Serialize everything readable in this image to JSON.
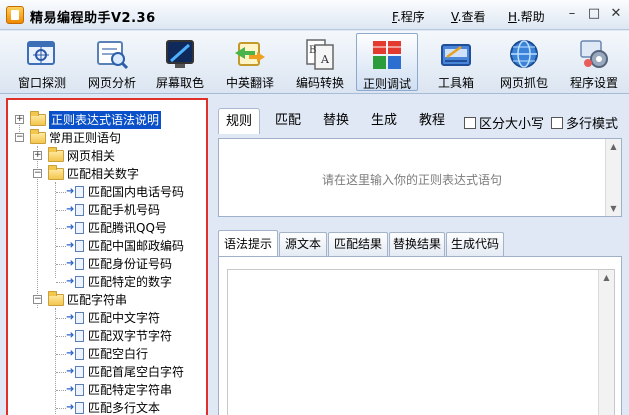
{
  "window": {
    "title": "精易编程助手V2.36",
    "menus": [
      {
        "accel": "F",
        "label": ".程序"
      },
      {
        "accel": "V",
        "label": ".查看"
      },
      {
        "accel": "H",
        "label": ".帮助"
      }
    ],
    "controls": {
      "minimize": "–",
      "maximize": "□",
      "close": "✕"
    }
  },
  "toolbar": {
    "items": [
      {
        "label": "窗口探测",
        "icon": "window-probe-icon"
      },
      {
        "label": "网页分析",
        "icon": "web-analysis-icon"
      },
      {
        "label": "屏幕取色",
        "icon": "color-picker-icon"
      },
      {
        "label": "中英翻译",
        "icon": "translate-icon"
      },
      {
        "label": "编码转换",
        "icon": "encoding-icon"
      },
      {
        "label": "正则调试",
        "icon": "regex-icon",
        "active": true
      },
      {
        "label": "工具箱",
        "icon": "toolbox-icon"
      },
      {
        "label": "网页抓包",
        "icon": "globe-icon"
      },
      {
        "label": "程序设置",
        "icon": "settings-icon"
      }
    ]
  },
  "tree": {
    "items": [
      {
        "label": "正则表达式语法说明",
        "level": 0,
        "type": "folder",
        "expander": "+",
        "selected": true
      },
      {
        "label": "常用正则语句",
        "level": 0,
        "type": "folder",
        "expander": "−"
      },
      {
        "label": "网页相关",
        "level": 1,
        "type": "folder",
        "expander": "+"
      },
      {
        "label": "匹配相关数字",
        "level": 1,
        "type": "folder",
        "expander": "−"
      },
      {
        "label": "匹配国内电话号码",
        "level": 2,
        "type": "doc"
      },
      {
        "label": "匹配手机号码",
        "level": 2,
        "type": "doc"
      },
      {
        "label": "匹配腾讯QQ号",
        "level": 2,
        "type": "doc"
      },
      {
        "label": "匹配中国邮政编码",
        "level": 2,
        "type": "doc"
      },
      {
        "label": "匹配身份证号码",
        "level": 2,
        "type": "doc"
      },
      {
        "label": "匹配特定的数字",
        "level": 2,
        "type": "doc"
      },
      {
        "label": "匹配字符串",
        "level": 1,
        "type": "folder",
        "expander": "−"
      },
      {
        "label": "匹配中文字符",
        "level": 2,
        "type": "doc"
      },
      {
        "label": "匹配双字节字符",
        "level": 2,
        "type": "doc"
      },
      {
        "label": "匹配空白行",
        "level": 2,
        "type": "doc"
      },
      {
        "label": "匹配首尾空白字符",
        "level": 2,
        "type": "doc"
      },
      {
        "label": "匹配特定字符串",
        "level": 2,
        "type": "doc"
      },
      {
        "label": "匹配多行文本",
        "level": 2,
        "type": "doc"
      }
    ]
  },
  "regex": {
    "tabs": [
      "规则",
      "匹配",
      "替换",
      "生成",
      "教程"
    ],
    "active_tab": "规则",
    "options": [
      {
        "label": "区分大小写",
        "checked": false
      },
      {
        "label": "多行模式",
        "checked": false
      }
    ],
    "input_placeholder": "请在这里输入你的正则表达式语句"
  },
  "results": {
    "tabs": [
      "语法提示",
      "源文本",
      "匹配结果",
      "替换结果",
      "生成代码"
    ],
    "active_tab": "语法提示"
  },
  "colors": {
    "accent_red": "#e0302a",
    "selection": "#0a50c8"
  }
}
